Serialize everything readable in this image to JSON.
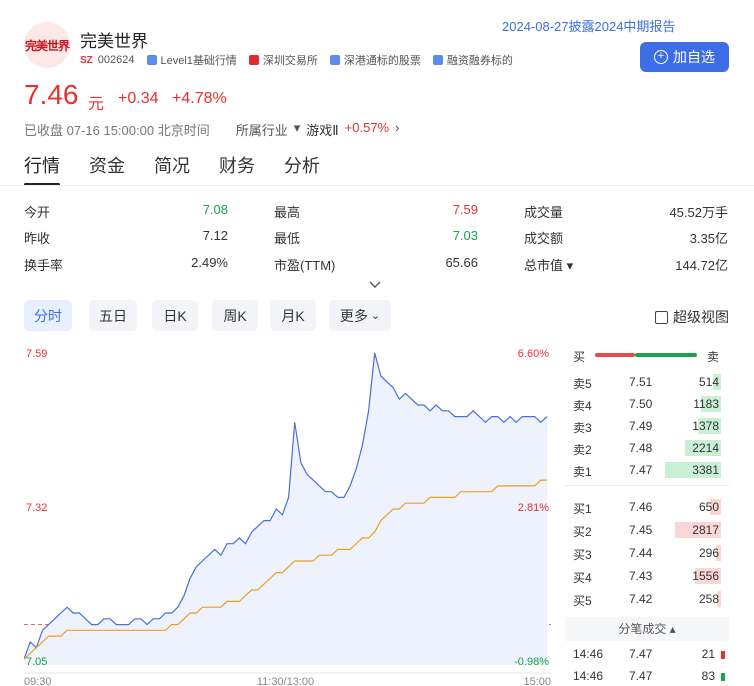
{
  "stock": {
    "logo_text": "完美世界",
    "name": "完美世界",
    "market": "SZ",
    "code": "002624",
    "tags": [
      "Level1基础行情",
      "深圳交易所",
      "深港通标的股票",
      "融资融券标的"
    ],
    "announcement": "2024-08-27披露2024中期报告",
    "add_button": "加自选"
  },
  "quote": {
    "price": "7.46",
    "unit": "元",
    "change": "+0.34",
    "change_pct": "+4.78%",
    "status": "已收盘 07-16 15:00:00 北京时间",
    "industry_label": "所属行业",
    "industry_name": "游戏Ⅱ",
    "industry_change": "+0.57%"
  },
  "tabs": [
    "行情",
    "资金",
    "简况",
    "财务",
    "分析"
  ],
  "stats": [
    {
      "label": "今开",
      "value": "7.08",
      "color": "#1aa34a"
    },
    {
      "label": "最高",
      "value": "7.59",
      "color": "#e93030"
    },
    {
      "label": "成交量",
      "value": "45.52万手",
      "color": "#333333"
    },
    {
      "label": "昨收",
      "value": "7.12",
      "color": "#333333"
    },
    {
      "label": "最低",
      "value": "7.03",
      "color": "#1aa34a"
    },
    {
      "label": "成交额",
      "value": "3.35亿",
      "color": "#333333"
    },
    {
      "label": "换手率",
      "value": "2.49%",
      "color": "#333333"
    },
    {
      "label": "市盈(TTM)",
      "value": "65.66",
      "color": "#333333"
    },
    {
      "label": "总市值",
      "value": "144.72亿",
      "color": "#333333"
    }
  ],
  "periods": [
    "分时",
    "五日",
    "日K",
    "周K",
    "月K",
    "更多"
  ],
  "super_view": "超级视图",
  "chart_data": {
    "type": "line",
    "y_left": [
      "7.59",
      "7.32",
      "7.05"
    ],
    "y_right": [
      "6.60%",
      "2.81%",
      "-0.98%"
    ],
    "x_labels": [
      "09:30",
      "11:30/13:00",
      "15:00"
    ],
    "ylim": [
      7.05,
      7.59
    ],
    "prev_close": 7.12,
    "series": [
      {
        "color": "#4a6fd6",
        "values": [
          7.06,
          7.09,
          7.08,
          7.11,
          7.12,
          7.13,
          7.14,
          7.15,
          7.14,
          7.14,
          7.13,
          7.12,
          7.12,
          7.13,
          7.13,
          7.12,
          7.12,
          7.12,
          7.13,
          7.13,
          7.12,
          7.13,
          7.13,
          7.14,
          7.14,
          7.15,
          7.17,
          7.2,
          7.22,
          7.23,
          7.24,
          7.25,
          7.24,
          7.26,
          7.26,
          7.27,
          7.26,
          7.28,
          7.29,
          7.3,
          7.3,
          7.32,
          7.31,
          7.34,
          7.47,
          7.4,
          7.38,
          7.37,
          7.36,
          7.35,
          7.35,
          7.34,
          7.34,
          7.36,
          7.39,
          7.43,
          7.49,
          7.59,
          7.55,
          7.54,
          7.53,
          7.51,
          7.52,
          7.51,
          7.5,
          7.5,
          7.49,
          7.5,
          7.49,
          7.49,
          7.48,
          7.48,
          7.48,
          7.49,
          7.48,
          7.47,
          7.48,
          7.48,
          7.47,
          7.48,
          7.47,
          7.48,
          7.48,
          7.48,
          7.47,
          7.48
        ]
      },
      {
        "color": "#f0a020",
        "values": [
          7.06,
          7.07,
          7.08,
          7.09,
          7.1,
          7.1,
          7.1,
          7.11,
          7.11,
          7.11,
          7.11,
          7.11,
          7.11,
          7.11,
          7.11,
          7.11,
          7.11,
          7.11,
          7.11,
          7.11,
          7.11,
          7.11,
          7.11,
          7.11,
          7.12,
          7.12,
          7.13,
          7.14,
          7.14,
          7.15,
          7.15,
          7.15,
          7.15,
          7.16,
          7.16,
          7.16,
          7.17,
          7.18,
          7.18,
          7.19,
          7.2,
          7.21,
          7.21,
          7.22,
          7.23,
          7.23,
          7.23,
          7.23,
          7.24,
          7.24,
          7.24,
          7.25,
          7.25,
          7.25,
          7.26,
          7.27,
          7.27,
          7.28,
          7.3,
          7.31,
          7.32,
          7.32,
          7.33,
          7.33,
          7.33,
          7.33,
          7.34,
          7.34,
          7.34,
          7.34,
          7.34,
          7.35,
          7.35,
          7.35,
          7.35,
          7.35,
          7.35,
          7.36,
          7.36,
          7.36,
          7.36,
          7.36,
          7.36,
          7.36,
          7.37,
          7.37
        ]
      }
    ]
  },
  "order_book": {
    "buy_label": "买",
    "sell_label": "卖",
    "asks": [
      {
        "label": "卖5",
        "price": "7.51",
        "vol": "514",
        "ratio": 0.15
      },
      {
        "label": "卖4",
        "price": "7.50",
        "vol": "1183",
        "ratio": 0.35
      },
      {
        "label": "卖3",
        "price": "7.49",
        "vol": "1378",
        "ratio": 0.41
      },
      {
        "label": "卖2",
        "price": "7.48",
        "vol": "2214",
        "ratio": 0.65
      },
      {
        "label": "卖1",
        "price": "7.47",
        "vol": "3381",
        "ratio": 1.0
      }
    ],
    "bids": [
      {
        "label": "买1",
        "price": "7.46",
        "vol": "650",
        "ratio": 0.19
      },
      {
        "label": "买2",
        "price": "7.45",
        "vol": "2817",
        "ratio": 0.83
      },
      {
        "label": "买3",
        "price": "7.44",
        "vol": "296",
        "ratio": 0.09
      },
      {
        "label": "买4",
        "price": "7.43",
        "vol": "1556",
        "ratio": 0.46
      },
      {
        "label": "买5",
        "price": "7.42",
        "vol": "258",
        "ratio": 0.08
      }
    ],
    "tick_title": "分笔成交",
    "ticks": [
      {
        "time": "14:46",
        "price": "7.47",
        "qty": "21",
        "dir": "buy"
      },
      {
        "time": "14:46",
        "price": "7.47",
        "qty": "83",
        "dir": "sell"
      }
    ]
  }
}
